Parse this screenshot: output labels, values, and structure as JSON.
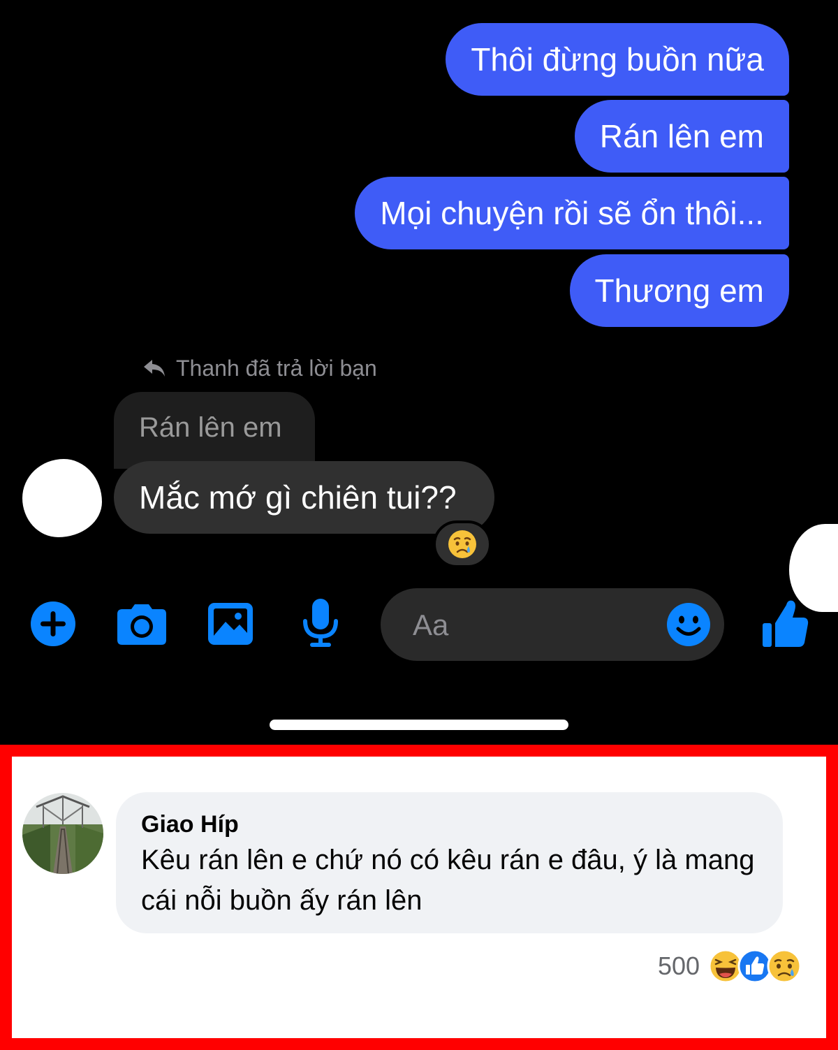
{
  "messages": {
    "outgoing": [
      "Thôi đừng buồn nữa",
      "Rán lên em",
      "Mọi chuyện rồi sẽ ổn thôi...",
      "Thương em"
    ],
    "reply_note": "Thanh đã trả lời bạn",
    "quoted_text": "Rán lên em",
    "incoming": "Mắc mớ gì chiên tui??",
    "incoming_reaction": "crying-face-emoji"
  },
  "composer": {
    "placeholder": "Aa"
  },
  "toolbar": {
    "icons": [
      "plus-icon",
      "camera-icon",
      "gallery-icon",
      "microphone-icon",
      "smiley-icon",
      "thumbs-up-icon"
    ],
    "accent": "#0a84ff"
  },
  "comment": {
    "author": "Giao Híp",
    "text": "Kêu rán lên e chứ nó có kêu rán e đâu, ý là mang cái nỗi buồn ấy rán lên",
    "reaction_count": "500",
    "reactions": [
      "haha-icon",
      "like-icon",
      "sad-icon"
    ]
  },
  "colors": {
    "outgoing_bubble": "#3f5cf7",
    "incoming_bubble": "#303030",
    "panel_border": "#ff0000"
  }
}
